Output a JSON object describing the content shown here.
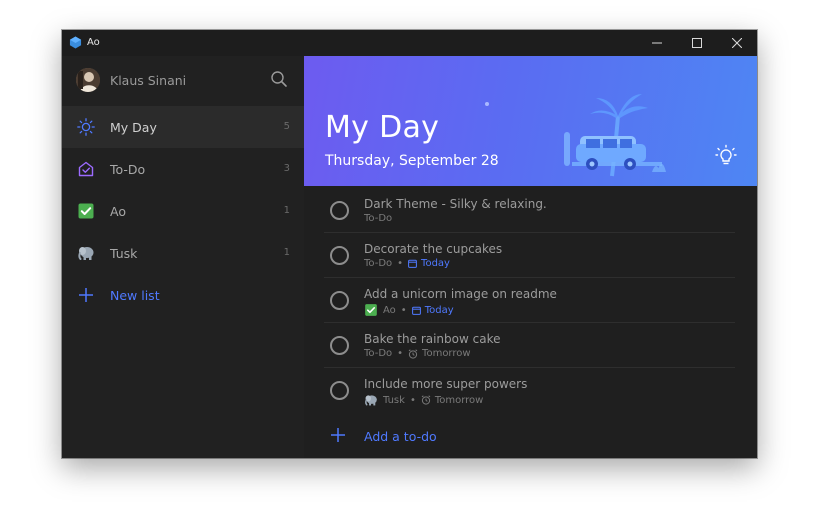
{
  "window": {
    "app_title": "Ao"
  },
  "sidebar": {
    "user_name": "Klaus Sinani",
    "items": [
      {
        "label": "My Day",
        "count": "5",
        "icon": "sun-icon",
        "active": true
      },
      {
        "label": "To-Do",
        "count": "3",
        "icon": "house-check-icon",
        "active": false
      },
      {
        "label": "Ao",
        "count": "1",
        "icon": "green-check-icon",
        "active": false
      },
      {
        "label": "Tusk",
        "count": "1",
        "icon": "elephant-icon",
        "active": false
      }
    ],
    "new_list_label": "New list"
  },
  "banner": {
    "title": "My Day",
    "date": "Thursday, September 28"
  },
  "tasks": [
    {
      "title": "Dark Theme - Silky & relaxing.",
      "list": "To-Do",
      "due": "",
      "reminder": ""
    },
    {
      "title": "Decorate the cupcakes",
      "list": "To-Do",
      "due": "Today",
      "reminder": ""
    },
    {
      "title": "Add a unicorn image on readme",
      "list": "Ao",
      "due": "Today",
      "reminder": ""
    },
    {
      "title": "Bake the rainbow cake",
      "list": "To-Do",
      "due": "",
      "reminder": "Tomorrow"
    },
    {
      "title": "Include more super powers",
      "list": "Tusk",
      "due": "",
      "reminder": "Tomorrow"
    }
  ],
  "add_todo_label": "Add a to-do",
  "colors": {
    "accent": "#4f79ff",
    "sidebar_bg": "#212121",
    "main_bg": "#1f1f1f",
    "banner_start": "#6d5bf0",
    "banner_end": "#4e86f3"
  }
}
